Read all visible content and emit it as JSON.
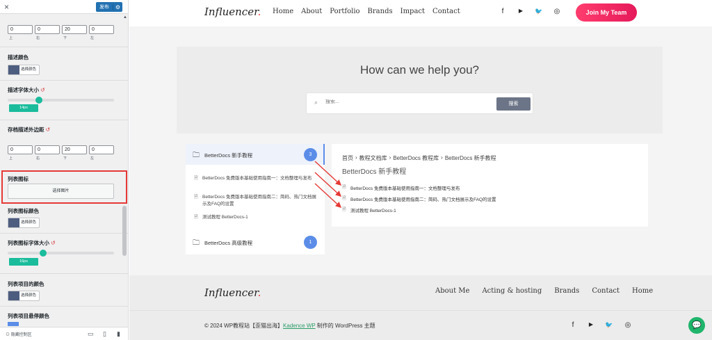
{
  "sidebar": {
    "close_icon": "×",
    "publish_label": "发布",
    "publish_gear": "⚙",
    "top_padding": {
      "values": [
        "0",
        "0",
        "20",
        "0"
      ],
      "labels": [
        "上",
        "右",
        "下",
        "左"
      ]
    },
    "desc_color": {
      "title": "描述颜色",
      "button": "选择颜色",
      "swatch": "#4d5d80"
    },
    "desc_font_size": {
      "title": "描述字体大小",
      "value": "14px"
    },
    "archive_margin": {
      "title": "存档描述外边距",
      "values": [
        "0",
        "0",
        "20",
        "0"
      ],
      "labels": [
        "上",
        "右",
        "下",
        "左"
      ]
    },
    "list_icon": {
      "title": "列表图标",
      "button": "选择图片"
    },
    "list_icon_color": {
      "title": "列表图标颜色",
      "button": "选择颜色"
    },
    "list_icon_font_size": {
      "title": "列表图标字体大小",
      "value": "16px"
    },
    "list_item_color": {
      "title": "列表项目的颜色",
      "button": "选择颜色"
    },
    "list_item_hover_color": {
      "title": "列表项目悬停颜色"
    },
    "reset_icon": "↺",
    "hide_controls": "隐藏控制区",
    "device_icons": [
      "desktop-icon",
      "tablet-icon",
      "mobile-icon"
    ]
  },
  "preview": {
    "logo": "Influencer",
    "logo_dot": ".",
    "nav": [
      "Home",
      "About",
      "Portfolio",
      "Brands",
      "Impact",
      "Contact"
    ],
    "social_icons": [
      "facebook-icon",
      "youtube-icon",
      "twitter-icon",
      "instagram-icon"
    ],
    "social_glyphs": [
      "f",
      "▶",
      "🐦",
      "◎"
    ],
    "join_button": "Join My Team",
    "hero_title": "How can we help you?",
    "search_placeholder": "搜索...",
    "search_button": "搜索",
    "categories": [
      {
        "name": "BetterDocs 新手教程",
        "count": "3"
      },
      {
        "name": "BetterDocs 高级教程",
        "count": "1"
      }
    ],
    "category_docs": [
      "BetterDocs 免费版本基础使用指南一：文档整理与发布",
      "BetterDocs 免费版本基础使用指南二：简码、热门文档展示及FAQ的设置",
      "测试教程 BetterDocs-1"
    ],
    "breadcrumb": [
      "首页",
      "教程文档库",
      "BetterDocs 教程库",
      "BetterDocs 新手教程"
    ],
    "breadcrumb_sep": "›",
    "doc_title": "BetterDocs 新手教程",
    "doc_list": [
      "BetterDocs 免费版本基础使用指南一：文档整理与发布",
      "BetterDocs 免费版本基础使用指南二：简码、热门文档展示及FAQ的设置",
      "测试教程 BetterDocs-1"
    ],
    "footer_nav": [
      "About Me",
      "Acting & hosting",
      "Brands",
      "Contact",
      "Home"
    ],
    "copyright_pre": "© 2024 WP教程站【歪猫出海】",
    "copyright_link": "Kadence WP",
    "copyright_post": " 制作的 WordPress 主题"
  },
  "colors": {
    "accent": "#5b8de8",
    "join_gradient_start": "#ff3d6e",
    "highlight_red": "#e53935",
    "slider": "#1abc9c"
  }
}
